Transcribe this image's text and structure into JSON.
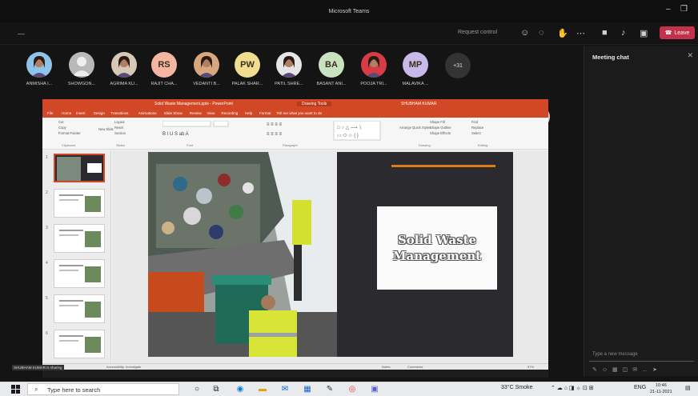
{
  "window": {
    "title": "Microsoft Teams",
    "minimize": "–",
    "maximize": "❐"
  },
  "toolbar": {
    "left_label": "‒‒",
    "request_control": "Request control",
    "leave_label": "Leave",
    "icons": [
      "people-icon",
      "chat-icon",
      "reactions-icon",
      "more-icon",
      "camera-icon",
      "mic-icon",
      "share-icon"
    ]
  },
  "participants": [
    {
      "name": "ANMISHA I...",
      "type": "photo",
      "color": "#8ec3ea"
    },
    {
      "name": "SHOWGON...",
      "type": "default",
      "color": "#b9b9b9"
    },
    {
      "name": "AGRIMA KU...",
      "type": "photo",
      "color": "#d8c9b7"
    },
    {
      "name": "RAJIT CHA...",
      "type": "initials",
      "initials": "RS",
      "color": "#f4b6a3"
    },
    {
      "name": "VEDANTI B...",
      "type": "photo",
      "color": "#d9a77f"
    },
    {
      "name": "PALAK SHAR...",
      "type": "initials",
      "initials": "PW",
      "color": "#f1dd8f"
    },
    {
      "name": "PATIL SHRE...",
      "type": "photo",
      "color": "#e6e6e6"
    },
    {
      "name": "BASANT ANI...",
      "type": "initials",
      "initials": "BA",
      "color": "#c9e3c1"
    },
    {
      "name": "POOJA TRI...",
      "type": "photo",
      "color": "#d63b46"
    },
    {
      "name": "MALAVIKA ...",
      "type": "initials",
      "initials": "MP",
      "color": "#c7b9e8"
    }
  ],
  "more_participants": "+31",
  "chat": {
    "title": "Meeting chat",
    "placeholder": "Type a new message"
  },
  "powerpoint": {
    "file_title": "Solid Waste Management.pptx - PowerPoint",
    "mode": "Drawing Tools",
    "user": "SHUBHAM KUMAR",
    "tabs": [
      "File",
      "Home",
      "Insert",
      "Design",
      "Transitions",
      "Animations",
      "Slide Show",
      "Review",
      "View",
      "Recording",
      "Help",
      "Format",
      "Tell me what you want to do"
    ],
    "ribbon": {
      "clipboard": [
        "Cut",
        "Copy",
        "Format Painter"
      ],
      "new_slide": "New Slide",
      "slides": [
        "Layout",
        "Reset",
        "Section"
      ],
      "groups": [
        "Clipboard",
        "Slides",
        "Font",
        "Paragraph",
        "Drawing",
        "Editing"
      ],
      "drawing": [
        "Shape Fill",
        "Shape Outline",
        "Shape Effects"
      ],
      "editing": [
        "Find",
        "Replace",
        "Select"
      ],
      "arrange": "Arrange",
      "quick_styles": "Quick Styles"
    },
    "slide_numbers": [
      "1",
      "2",
      "3",
      "4",
      "5",
      "6"
    ],
    "slide": {
      "title_line1": "Solid Waste",
      "title_line2": "Management"
    },
    "status": {
      "slide_info": "Slide 1 of 14",
      "accessibility": "Accessibility: Investigate",
      "notes": "Notes",
      "comments": "Comments",
      "zoom": "57%"
    },
    "remote_label": "SHUBHAM KUMAR is sharing"
  },
  "taskbar": {
    "search_placeholder": "Type here to search",
    "weather": "33°C Smoke",
    "lang": "ENG",
    "time": "10:46",
    "date": "21-11-2021"
  }
}
